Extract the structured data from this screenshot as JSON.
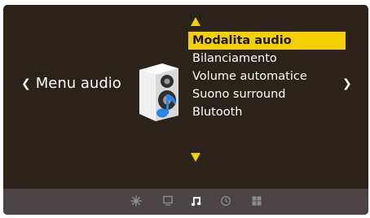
{
  "nav": {
    "left_label": "Menu audio",
    "left_chevron": "❮",
    "right_chevron": "❯"
  },
  "menu": {
    "items": [
      {
        "label": "Modalita audio",
        "selected": true
      },
      {
        "label": "Bilanciamento",
        "selected": false
      },
      {
        "label": "Volume automatice",
        "selected": false
      },
      {
        "label": "Suono surround",
        "selected": false
      },
      {
        "label": "Blutooth",
        "selected": false
      }
    ]
  },
  "category_icon": "speaker-with-note-icon",
  "bottom_bar": {
    "icons": [
      {
        "name": "picture-settings-icon",
        "active": false
      },
      {
        "name": "tv-icon",
        "active": false
      },
      {
        "name": "music-note-icon",
        "active": true
      },
      {
        "name": "clock-icon",
        "active": false
      },
      {
        "name": "grid-icon",
        "active": false
      }
    ]
  },
  "colors": {
    "background": "#2b2219",
    "highlight": "#f5d000",
    "bottom_bar": "#4b4446",
    "text": "#ffffff",
    "icon_inactive": "#8f8a8b"
  }
}
